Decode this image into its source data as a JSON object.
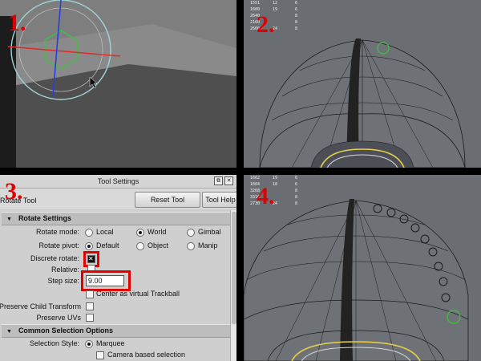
{
  "steps": [
    "1.",
    "2.",
    "3.",
    "4."
  ],
  "hud2": [
    [
      "1551",
      "12",
      "6"
    ],
    [
      "1600",
      "19",
      "6"
    ],
    [
      "2640",
      "",
      "8"
    ],
    [
      "2160",
      "",
      "8"
    ],
    [
      "2600",
      "24",
      "8"
    ]
  ],
  "hud4": [
    [
      "1662",
      "19",
      "6"
    ],
    [
      "1604",
      "18",
      "6"
    ],
    [
      "3268",
      "",
      "8"
    ],
    [
      "3316",
      "",
      "8"
    ],
    [
      "2730",
      "24",
      "8"
    ]
  ],
  "tool_settings": {
    "window_title": "Tool Settings",
    "tool_name": "Rotate Tool",
    "reset_button": "Reset Tool",
    "help_button": "Tool Help",
    "rotate_section": "Rotate Settings",
    "rotate_mode": {
      "label": "Rotate mode:",
      "options": [
        "Local",
        "World",
        "Gimbal"
      ],
      "selected": "World"
    },
    "rotate_pivot": {
      "label": "Rotate pivot:",
      "options": [
        "Default",
        "Object",
        "Manip"
      ],
      "selected": "Default"
    },
    "discrete_rotate": {
      "label": "Discrete rotate:",
      "checked": true
    },
    "relative": {
      "label": "Relative:"
    },
    "step_size": {
      "label": "Step size:",
      "value": "9.00"
    },
    "trackball": "Center as virtual Trackball",
    "preserve_child": "Preserve Child Transform",
    "preserve_uvs": "Preserve UVs",
    "selection_section": "Common Selection Options",
    "selection_style": {
      "label": "Selection Style:",
      "value": "Marquee"
    },
    "camera_based": "Camera based selection"
  },
  "colors": {
    "accent": "#e00000",
    "mesh": "#6e7277",
    "manip_red": "#e02a2a",
    "manip_blue": "#2a3ee0",
    "manip_green": "#3ec23e"
  }
}
